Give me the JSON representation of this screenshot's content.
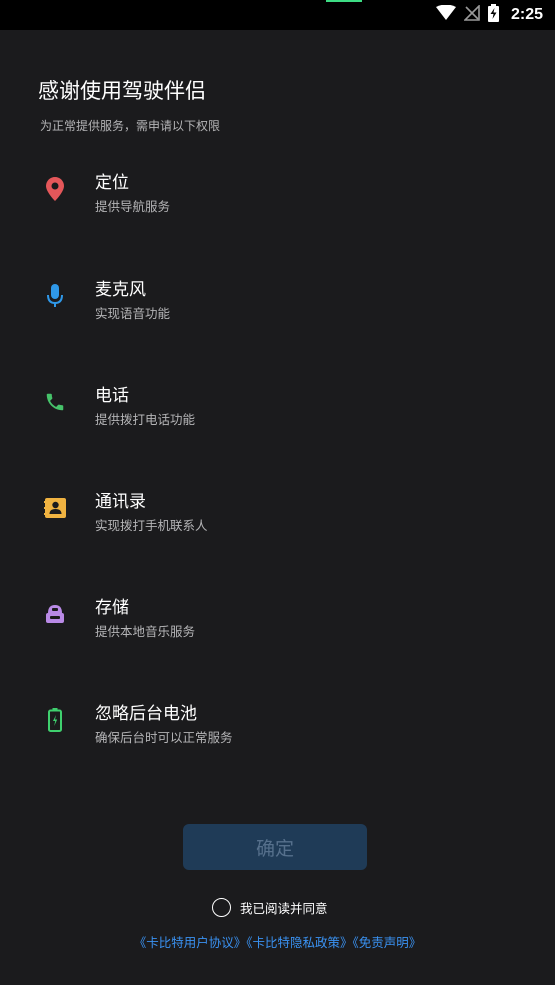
{
  "status_bar": {
    "time": "2:25",
    "icons": [
      "wifi-icon",
      "no-signal-icon",
      "battery-charging-icon"
    ]
  },
  "header": {
    "title": "感谢使用驾驶伴侣",
    "subtitle": "为正常提供服务，需申请以下权限"
  },
  "permissions": [
    {
      "icon": "location-pin-icon",
      "color": "#e5575a",
      "title": "定位",
      "desc": "提供导航服务"
    },
    {
      "icon": "microphone-icon",
      "color": "#2f98e8",
      "title": "麦克风",
      "desc": "实现语音功能"
    },
    {
      "icon": "phone-icon",
      "color": "#46c36a",
      "title": "电话",
      "desc": "提供拨打电话功能"
    },
    {
      "icon": "contacts-book-icon",
      "color": "#f0b341",
      "title": "通讯录",
      "desc": "实现拨打手机联系人"
    },
    {
      "icon": "storage-icon",
      "color": "#b98ae6",
      "title": "存储",
      "desc": "提供本地音乐服务"
    },
    {
      "icon": "battery-icon",
      "color": "#3fd06e",
      "title": "忽略后台电池",
      "desc": "确保后台时可以正常服务"
    }
  ],
  "confirm_button": {
    "label": "确定"
  },
  "agreement": {
    "checkbox_label": "我已阅读并同意",
    "checked": false,
    "links": [
      "《卡比特用户协议》",
      "《卡比特隐私政策》",
      "《免责声明》"
    ]
  },
  "colors": {
    "background": "#1b1b1d",
    "link": "#3a92f2",
    "button_bg": "#1f3b57",
    "button_text": "#56708c"
  }
}
